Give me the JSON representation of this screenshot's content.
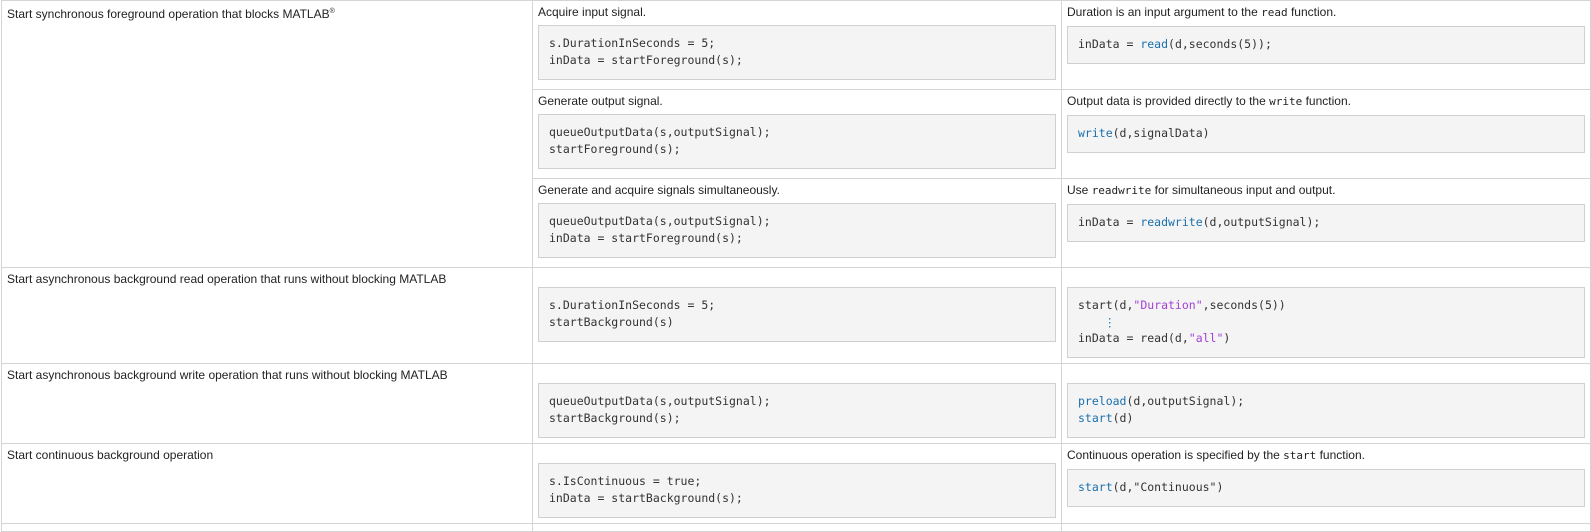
{
  "rows": {
    "sync": {
      "task": "Start synchronous foreground operation that blocks MATLAB",
      "task_sup": "®",
      "acquire": {
        "old_note": "Acquire input signal.",
        "old_code": [
          "s.DurationInSeconds = 5;",
          "inData = startForeground(s);"
        ],
        "new_note_pre": "Duration is an input argument to the ",
        "new_note_code": "read",
        "new_note_post": " function.",
        "new_code_lhs": "inData = ",
        "new_code_fn": "read",
        "new_code_rest": "(d,seconds(5));"
      },
      "generate": {
        "old_note": "Generate output signal.",
        "old_code": [
          "queueOutputData(s,outputSignal);",
          "startForeground(s);"
        ],
        "new_note_pre": "Output data is provided directly to the ",
        "new_note_code": "write",
        "new_note_post": " function.",
        "new_code_fn": "write",
        "new_code_rest": "(d,signalData)"
      },
      "both": {
        "old_note": "Generate and acquire signals simultaneously.",
        "old_code": [
          "queueOutputData(s,outputSignal);",
          "inData = startForeground(s);"
        ],
        "new_note_pre": "Use ",
        "new_note_code": "readwrite",
        "new_note_post": " for simultaneous input and output.",
        "new_code_lhs": "inData = ",
        "new_code_fn": "readwrite",
        "new_code_rest": "(d,outputSignal);"
      }
    },
    "bg_read": {
      "task": "Start asynchronous background read operation that runs without blocking MATLAB",
      "old_code": [
        "s.DurationInSeconds = 5;",
        "startBackground(s)"
      ],
      "new_line1_a": "start(d,",
      "new_line1_str": "\"Duration\"",
      "new_line1_b": ",seconds(5))",
      "new_vdots": "⋮",
      "new_line3_a": "inData = read(d,",
      "new_line3_str": "\"all\"",
      "new_line3_b": ")"
    },
    "bg_write": {
      "task": "Start asynchronous background write operation that runs without blocking MATLAB",
      "old_code": [
        "queueOutputData(s,outputSignal);",
        "startBackground(s);"
      ],
      "new_line1_fn": "preload",
      "new_line1_rest": "(d,outputSignal);",
      "new_line2_fn": "start",
      "new_line2_rest": "(d)"
    },
    "continuous": {
      "task": "Start continuous background operation",
      "old_code": [
        "s.IsContinuous = true;",
        "inData = startBackground(s);"
      ],
      "new_note_pre": "Continuous operation is specified by the ",
      "new_note_code": "start",
      "new_note_post": " function.",
      "new_code_fn": "start",
      "new_code_rest": "(d,\"Continuous\")"
    }
  },
  "colors": {
    "function_blue": "#1a70ad",
    "string_purple": "#a33fd6",
    "code_background": "#f4f4f4",
    "border": "#d4d4d4"
  }
}
